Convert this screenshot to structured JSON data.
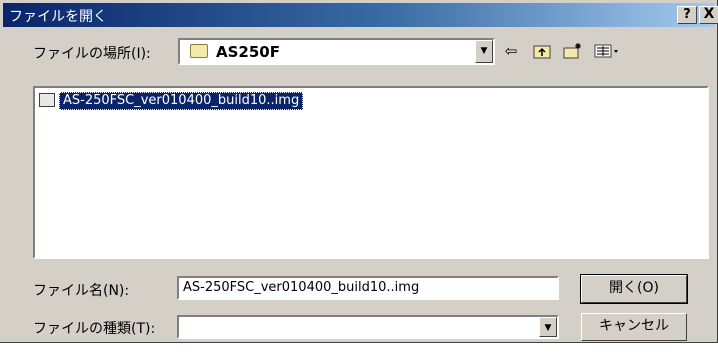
{
  "title": "ファイルを開く",
  "help_button": "?",
  "close_button": "X",
  "location": {
    "label": "ファイルの場所(I):",
    "value": "AS250F"
  },
  "toolbar": {
    "back_icon": "back-arrow-icon",
    "up_icon": "up-folder-icon",
    "new_folder_icon": "new-folder-icon",
    "view_icon": "view-menu-icon"
  },
  "files": [
    {
      "name": "AS-250FSC_ver010400_build10..img",
      "icon": "disk-image-icon",
      "selected": true
    }
  ],
  "filename": {
    "label": "ファイル名(N):",
    "value": "AS-250FSC_ver010400_build10..img"
  },
  "filetype": {
    "label": "ファイルの種類(T):",
    "value": ""
  },
  "open_button": "開く(O)",
  "cancel_button": "キャンセル",
  "colors": {
    "title_gradient_start": "#0a246a",
    "title_gradient_end": "#a6caf0",
    "face": "#d4d0c8",
    "selection": "#0a246a"
  }
}
